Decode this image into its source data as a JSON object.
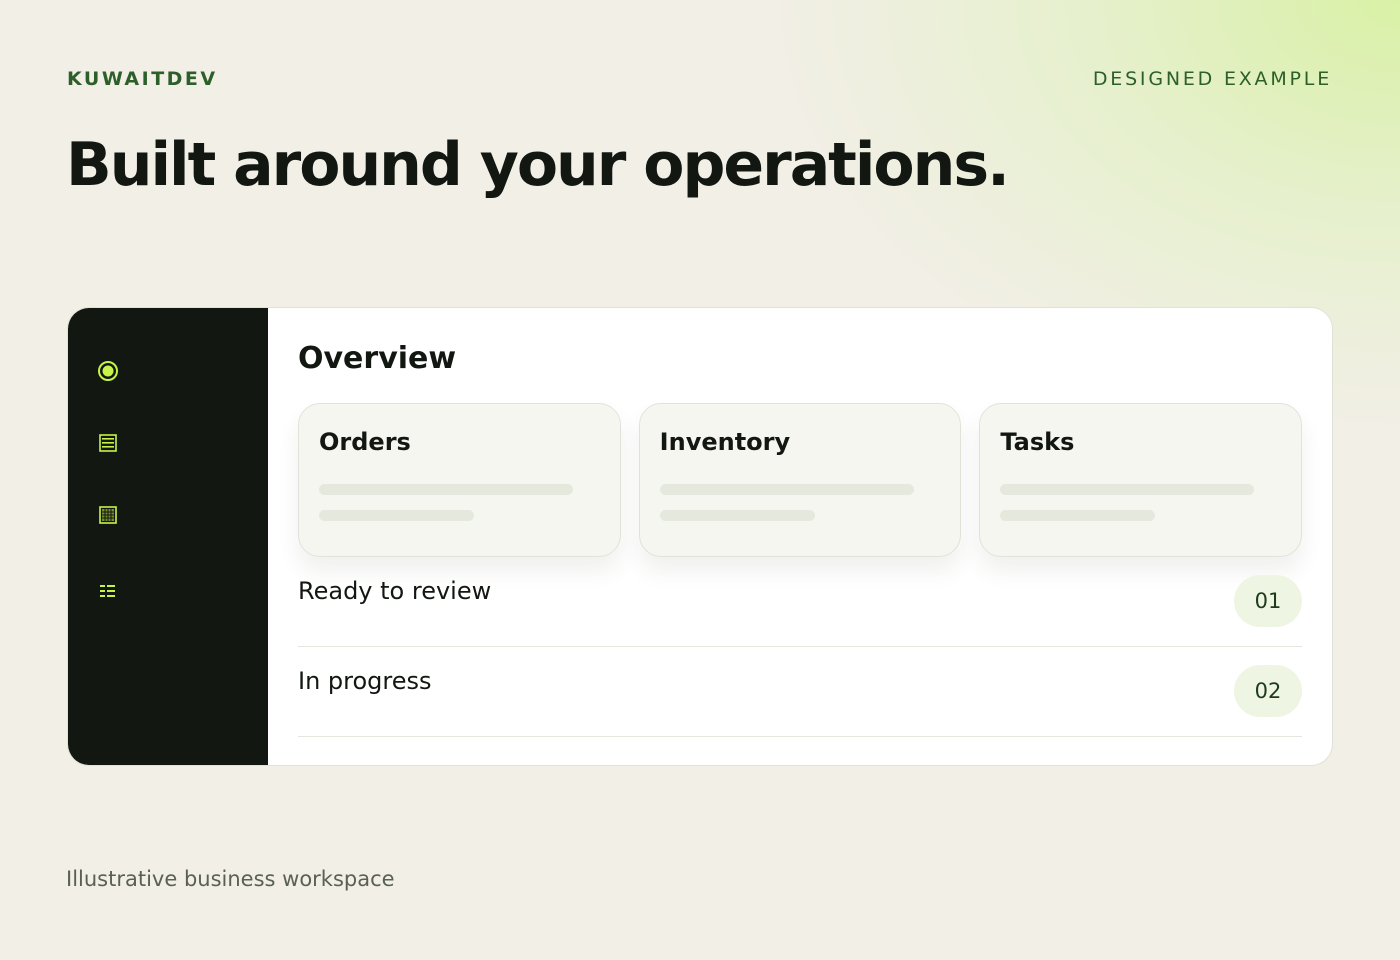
{
  "header": {
    "brand": "KUWAITDEV",
    "tag": "DESIGNED EXAMPLE",
    "headline": "Built around your operations."
  },
  "sidebar": {
    "items": [
      {
        "icon": "target-icon"
      },
      {
        "icon": "list-icon"
      },
      {
        "icon": "grid-icon"
      },
      {
        "icon": "checklist-icon"
      }
    ]
  },
  "main": {
    "title": "Overview",
    "tiles": [
      {
        "label": "Orders"
      },
      {
        "label": "Inventory"
      },
      {
        "label": "Tasks"
      }
    ],
    "rows": [
      {
        "label": "Ready to review",
        "count": "01"
      },
      {
        "label": "In progress",
        "count": "02"
      }
    ]
  },
  "caption": "Illustrative business workspace",
  "colors": {
    "accent": "#c6f24a",
    "brand_green": "#2d5f2a",
    "sidebar": "#121711",
    "pill": "#eef5e2"
  }
}
